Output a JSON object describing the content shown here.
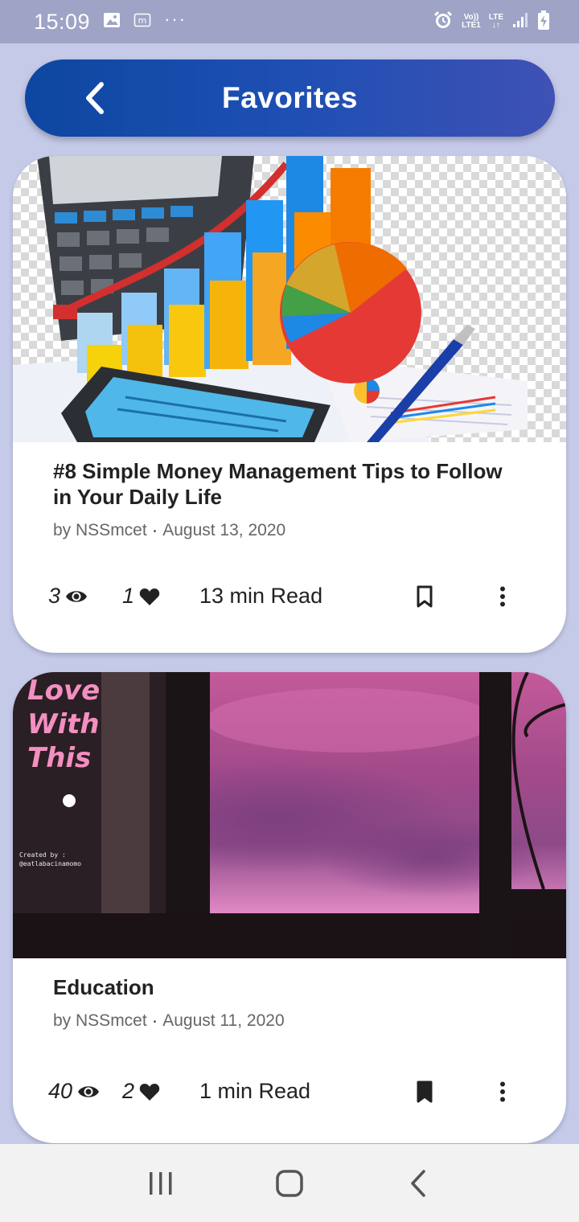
{
  "status_bar": {
    "time": "15:09",
    "left_icons": [
      "image-icon",
      "m-badge-icon",
      "more-dots-icon"
    ],
    "right_icons": [
      "alarm-icon",
      "volte-icon",
      "lte-icon",
      "signal-icon",
      "battery-charging-icon"
    ],
    "volte_top": "Vo))",
    "volte_bottom": "LTE1",
    "lte_label": "LTE",
    "dots": "···"
  },
  "header": {
    "title": "Favorites",
    "back_icon": "chevron-left-icon",
    "gradient": [
      "#0d47a1",
      "#3f51b5"
    ]
  },
  "posts": [
    {
      "title": "#8 Simple Money Management Tips to Follow in Your Daily Life",
      "author": "by NSSmcet",
      "separator": "•",
      "date": "August 13, 2020",
      "views": "3",
      "likes": "1",
      "read_time": "13 min Read",
      "bookmarked": false
    },
    {
      "title": "Education",
      "author": "by NSSmcet",
      "separator": "•",
      "date": "August 11, 2020",
      "views": "40",
      "likes": "2",
      "read_time": "1 min Read",
      "bookmarked": true,
      "image_text": [
        "Love",
        "With",
        "This"
      ],
      "image_caption": [
        "Created by :",
        "@eatlabacinamomo"
      ]
    }
  ],
  "colors": {
    "background": "#c5cae9",
    "status_bar": "#9fa3c6",
    "card": "#ffffff",
    "text_primary": "#222222",
    "text_secondary": "#666666"
  },
  "nav": {
    "buttons": [
      "recent-apps-icon",
      "home-icon",
      "back-icon"
    ]
  }
}
